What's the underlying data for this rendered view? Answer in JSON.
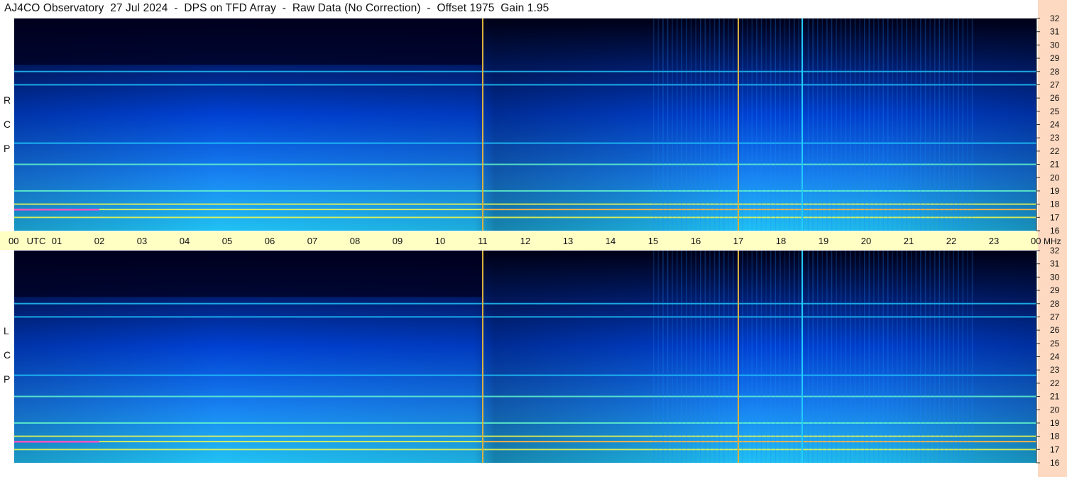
{
  "header": {
    "title": "AJ4CO Observatory  27 Jul 2024  -  DPS on TFD Array  -  Raw Data (No Correction)  -  Offset 1975  Gain 1.95"
  },
  "panels": {
    "top_label": [
      "R",
      "C",
      "P"
    ],
    "bottom_label": [
      "L",
      "C",
      "P"
    ]
  },
  "colors": {
    "background": "#ffffff",
    "utc_bar": "#ffffc4",
    "freq_strip": "#fcd9c0",
    "marker_line": "#d8b040",
    "colormap": [
      "#000018",
      "#001a66",
      "#0044dd",
      "#1a8cff",
      "#22ccff",
      "#66ffcc",
      "#ffff44",
      "#ff8844",
      "#ff44cc"
    ]
  },
  "chart_data": {
    "type": "heatmap",
    "title": "AJ4CO Observatory  27 Jul 2024  -  DPS on TFD Array  -  Raw Data (No Correction)  -  Offset 1975  Gain 1.95",
    "x_axis": {
      "quantity": "UTC",
      "range": [
        0,
        24
      ],
      "tick_labels": [
        "00",
        "UTC",
        "01",
        "02",
        "03",
        "04",
        "05",
        "06",
        "07",
        "08",
        "09",
        "10",
        "11",
        "12",
        "13",
        "14",
        "15",
        "16",
        "17",
        "18",
        "19",
        "20",
        "21",
        "22",
        "23",
        "00"
      ]
    },
    "y_axis": {
      "unit": "MHz",
      "range": [
        16,
        32
      ],
      "tick_labels": [
        "32",
        "31",
        "30",
        "29",
        "28",
        "27",
        "26",
        "25",
        "24",
        "23",
        "22",
        "21",
        "20",
        "19",
        "18",
        "17",
        "16"
      ]
    },
    "panels": [
      {
        "name": "RCP",
        "interference_bands_mhz": [
          17.0,
          17.6,
          18.0,
          19.0,
          21.0,
          22.6,
          27.0,
          28.0
        ],
        "time_markers_utc": [
          11,
          17,
          18.5
        ]
      },
      {
        "name": "LCP",
        "interference_bands_mhz": [
          17.0,
          17.6,
          18.0,
          19.0,
          21.0,
          22.6,
          27.0,
          28.0
        ],
        "time_markers_utc": [
          11,
          17,
          18.5
        ]
      }
    ]
  }
}
